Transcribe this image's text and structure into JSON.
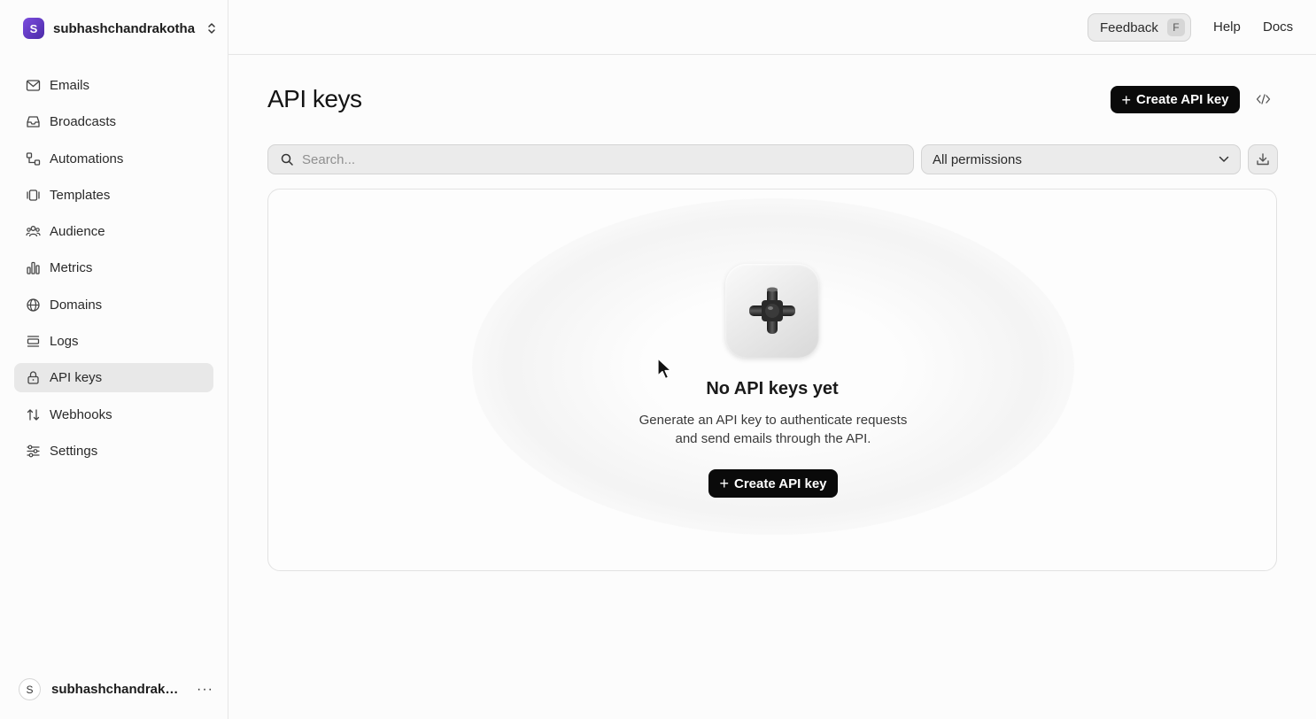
{
  "sidebar": {
    "team": {
      "initial": "S",
      "name": "subhashchandrakotha"
    },
    "items": [
      {
        "label": "Emails",
        "icon": "mail-icon"
      },
      {
        "label": "Broadcasts",
        "icon": "inbox-icon"
      },
      {
        "label": "Automations",
        "icon": "automation-icon"
      },
      {
        "label": "Templates",
        "icon": "templates-icon"
      },
      {
        "label": "Audience",
        "icon": "users-icon"
      },
      {
        "label": "Metrics",
        "icon": "bar-chart-icon"
      },
      {
        "label": "Domains",
        "icon": "globe-icon"
      },
      {
        "label": "Logs",
        "icon": "logs-icon"
      },
      {
        "label": "API keys",
        "icon": "lock-icon",
        "active": true
      },
      {
        "label": "Webhooks",
        "icon": "arrows-icon"
      },
      {
        "label": "Settings",
        "icon": "sliders-icon"
      }
    ],
    "user": {
      "initial": "S",
      "name": "subhashchandrakotha",
      "more": "···"
    }
  },
  "topbar": {
    "feedback": {
      "label": "Feedback",
      "shortcut": "F"
    },
    "help": "Help",
    "docs": "Docs"
  },
  "main": {
    "title": "API keys",
    "create_button": "Create API key",
    "search": {
      "placeholder": "Search...",
      "value": ""
    },
    "permissions_select": {
      "selected": "All permissions"
    },
    "empty": {
      "title": "No API keys yet",
      "description": "Generate an API key to authenticate requests and send emails through the API.",
      "button": "Create API key"
    }
  },
  "colors": {
    "accent": "#0a0a0a",
    "sidebar_active": "#e8e8e8",
    "team_avatar": "#6a3fd0"
  }
}
